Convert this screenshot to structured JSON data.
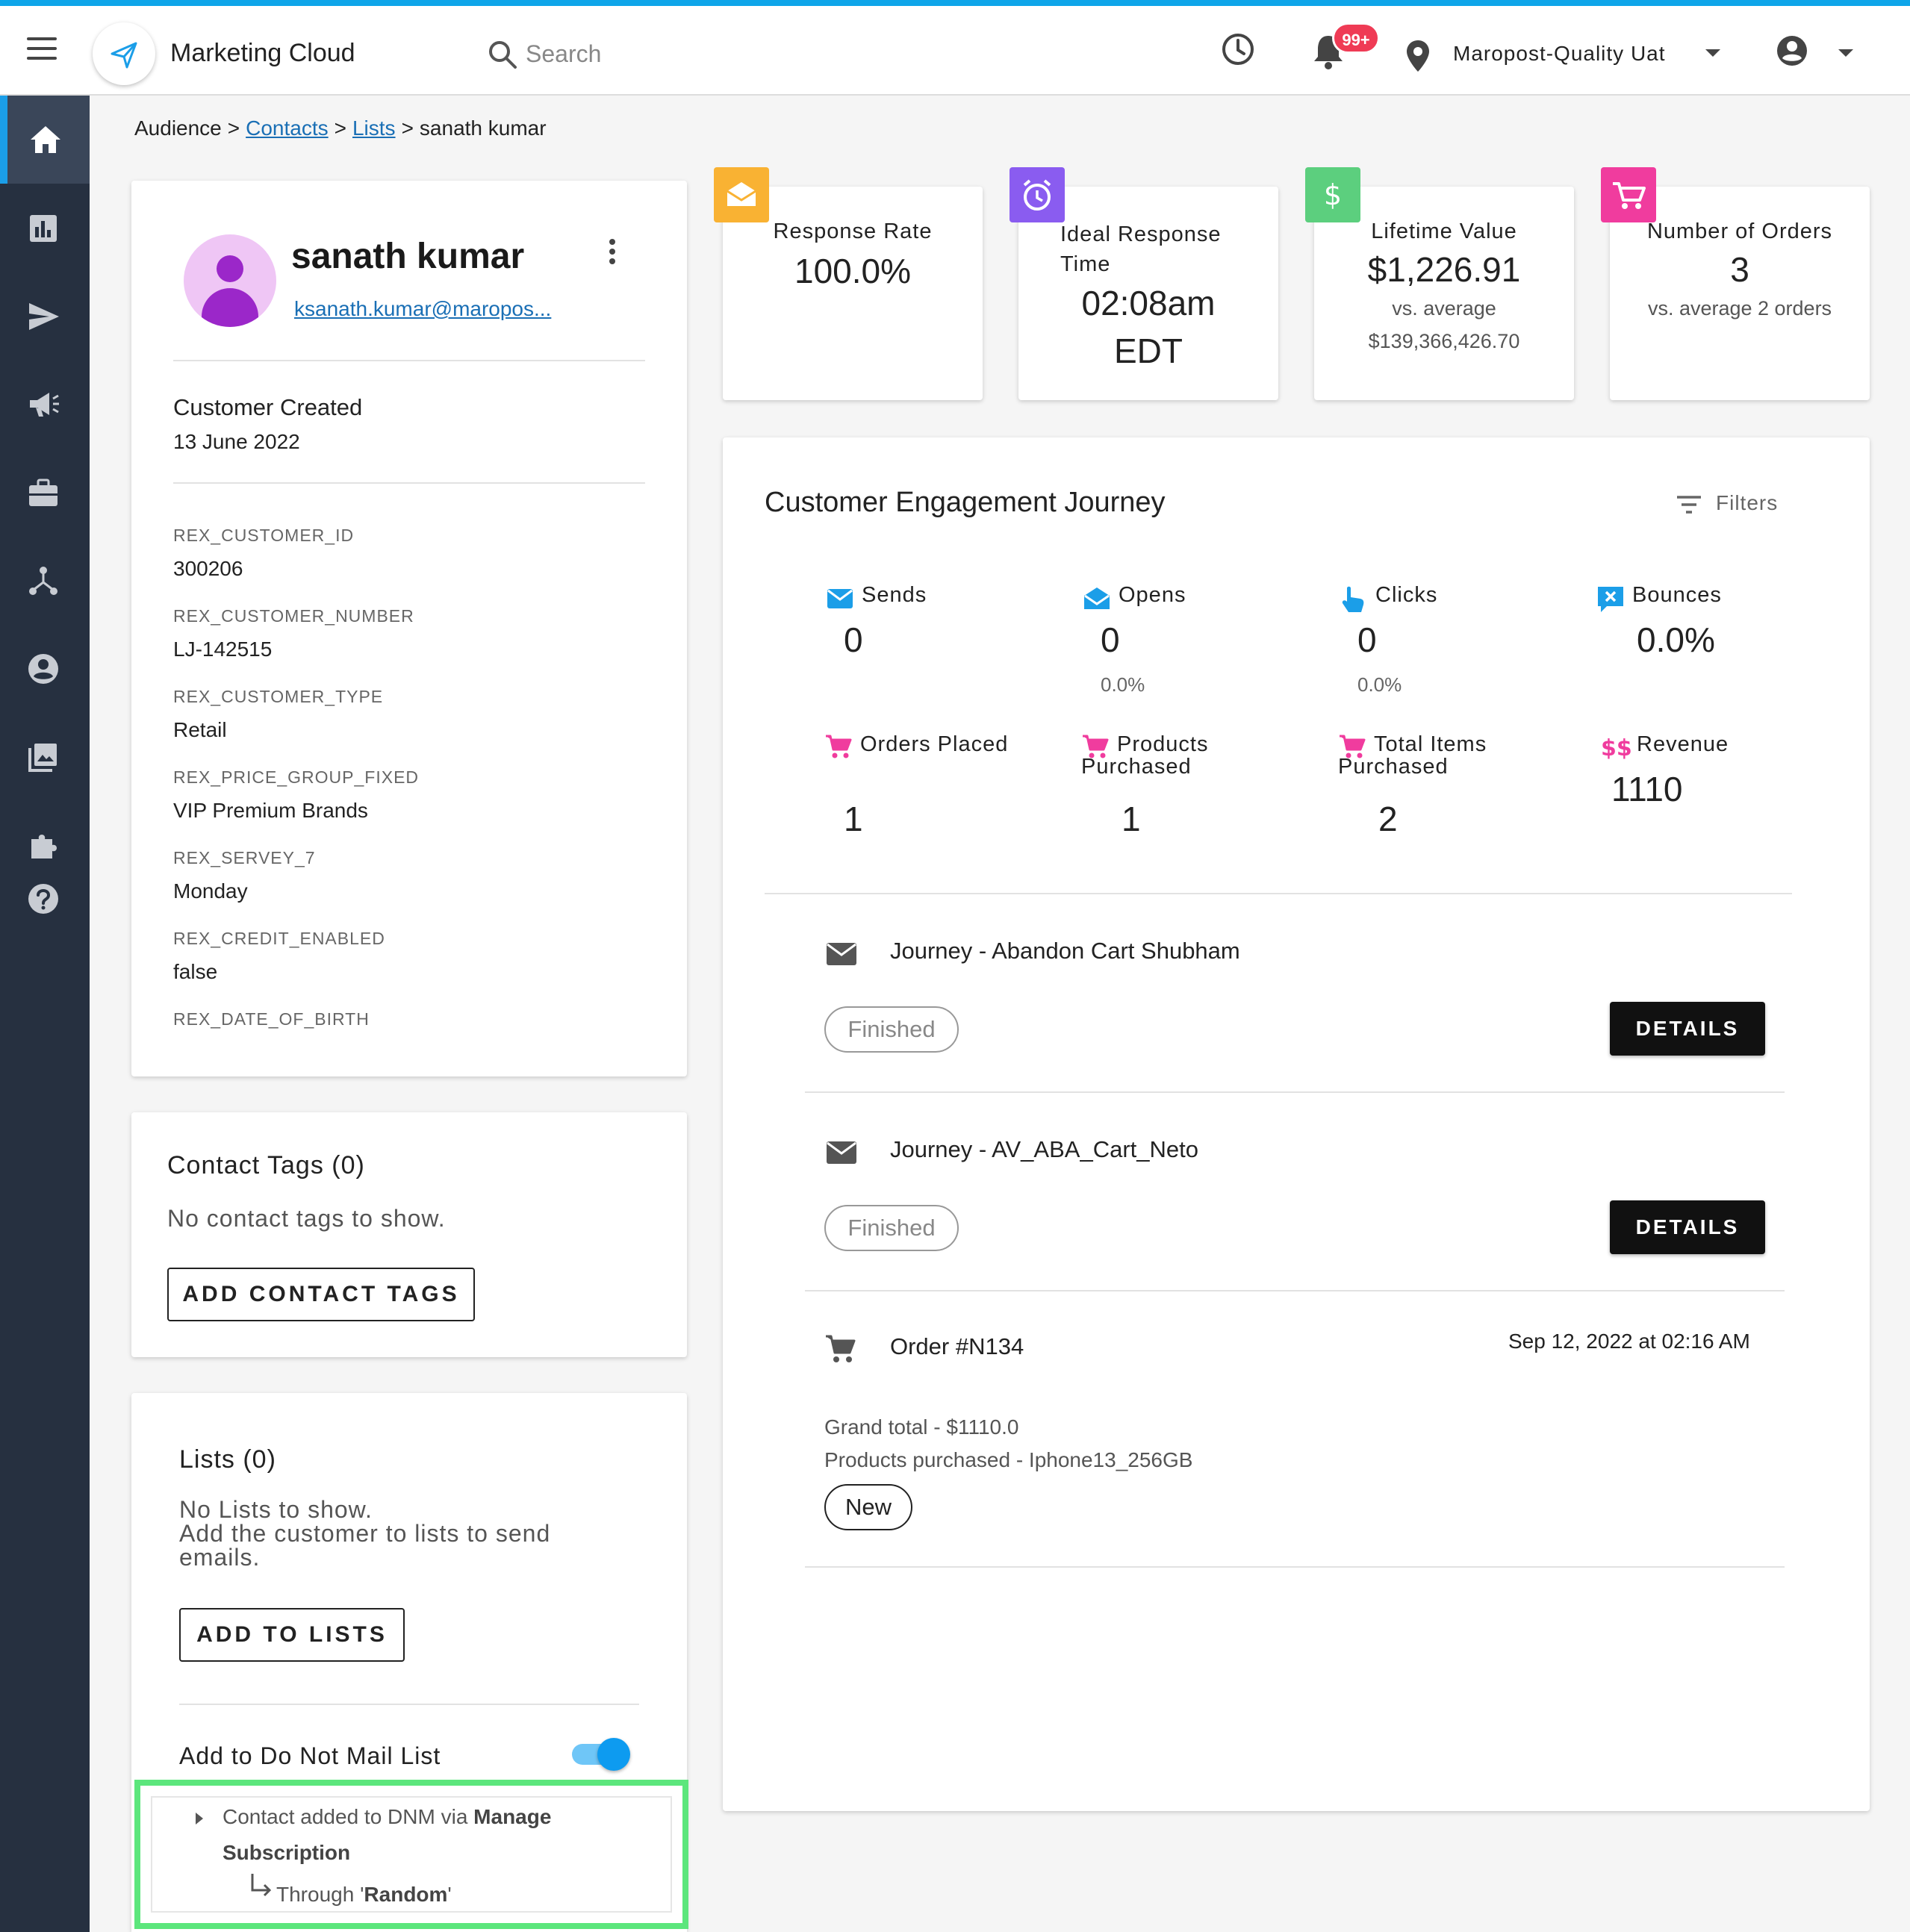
{
  "header": {
    "app_title": "Marketing Cloud",
    "search_placeholder": "Search",
    "notifications_badge": "99+",
    "account_name": "Maropost-Quality Uat"
  },
  "sidebar": {
    "items": [
      {
        "icon": "home-icon",
        "active": true
      },
      {
        "icon": "bar-chart-icon"
      },
      {
        "icon": "send-icon"
      },
      {
        "icon": "megaphone-icon"
      },
      {
        "icon": "briefcase-icon"
      },
      {
        "icon": "hierarchy-icon"
      },
      {
        "icon": "account-circle-icon"
      },
      {
        "icon": "image-library-icon"
      },
      {
        "icon": "puzzle-icon"
      },
      {
        "icon": "help-icon"
      }
    ]
  },
  "breadcrumb": {
    "root": "Audience",
    "contacts": "Contacts",
    "lists": "Lists",
    "current": "sanath kumar",
    "separator": ">"
  },
  "profile": {
    "name": "sanath kumar",
    "email": "ksanath.kumar@maropos...",
    "created_label": "Customer Created",
    "created_date": "13 June 2022",
    "fields": [
      {
        "label": "REX_CUSTOMER_ID",
        "value": "300206"
      },
      {
        "label": "REX_CUSTOMER_NUMBER",
        "value": "LJ-142515"
      },
      {
        "label": "REX_CUSTOMER_TYPE",
        "value": "Retail"
      },
      {
        "label": "REX_PRICE_GROUP_FIXED",
        "value": "VIP Premium Brands"
      },
      {
        "label": "REX_SERVEY_7",
        "value": "Monday"
      },
      {
        "label": "REX_CREDIT_ENABLED",
        "value": "false"
      },
      {
        "label": "REX_DATE_OF_BIRTH",
        "value": ""
      }
    ]
  },
  "contact_tags": {
    "title": "Contact Tags (0)",
    "empty_text": "No contact tags to show.",
    "button": "ADD CONTACT TAGS"
  },
  "lists": {
    "title": "Lists (0)",
    "empty_line1": "No Lists to show.",
    "empty_line2": "Add the customer to lists to send",
    "empty_line3": "emails.",
    "button": "ADD TO LISTS",
    "dnm_label": "Add to Do Not Mail List",
    "dnm_enabled": true,
    "dnm_note_prefix": "Contact added to DNM via ",
    "dnm_note_bold1": "Manage",
    "dnm_note_bold2": "Subscription",
    "dnm_through_prefix": "Through '",
    "dnm_through_value": "Random",
    "dnm_through_suffix": "'"
  },
  "stats": [
    {
      "label": "Response Rate",
      "value": "100.0%",
      "icon": "mail-open-icon",
      "color": "#f9b233"
    },
    {
      "label_line1": "Ideal Response",
      "label_line2": "Time",
      "value_line1": "02:08am",
      "value_line2": "EDT",
      "icon": "alarm-icon",
      "color": "#8a5cf0"
    },
    {
      "label": "Lifetime Value",
      "value": "$1,226.91",
      "sub_line1": "vs. average",
      "sub_line2": "$139,366,426.70",
      "icon": "dollar-icon",
      "color": "#5ccf7e"
    },
    {
      "label": "Number of Orders",
      "value": "3",
      "sub_line1": "vs. average 2 orders",
      "icon": "cart-icon",
      "color": "#f03c9e"
    }
  ],
  "engagement": {
    "title": "Customer Engagement Journey",
    "filters_label": "Filters",
    "metrics": [
      {
        "label": "Sends",
        "value": "0",
        "sub": "",
        "icon": "mail-icon"
      },
      {
        "label": "Opens",
        "value": "0",
        "sub": "0.0%",
        "icon": "mail-open-icon"
      },
      {
        "label": "Clicks",
        "value": "0",
        "sub": "0.0%",
        "icon": "pointer-icon"
      },
      {
        "label": "Bounces",
        "value": "0.0%",
        "sub": "",
        "icon": "bounce-icon"
      },
      {
        "label": "Orders Placed",
        "value": "1",
        "icon": "cart-icon"
      },
      {
        "label": "Products Purchased",
        "value": "1",
        "icon": "cart-icon"
      },
      {
        "label": "Total Items Purchased",
        "value": "2",
        "icon": "cart-icon"
      },
      {
        "label": "Revenue",
        "value": "1110",
        "icon": "double-dollar-icon"
      }
    ],
    "journeys": [
      {
        "title": "Journey - Abandon Cart Shubham",
        "status": "Finished",
        "button": "DETAILS"
      },
      {
        "title": "Journey - AV_ABA_Cart_Neto",
        "status": "Finished",
        "button": "DETAILS"
      }
    ],
    "order": {
      "title": "Order #N134",
      "date": "Sep 12, 2022 at 02:16 AM",
      "grand_total": "Grand total - $1110.0",
      "products": "Products purchased - Iphone13_256GB",
      "status": "New"
    }
  },
  "colors": {
    "accent": "#1b9ee8",
    "sidebar": "#263040",
    "highlight": "#5ce67c",
    "badge": "#ef3b55"
  }
}
